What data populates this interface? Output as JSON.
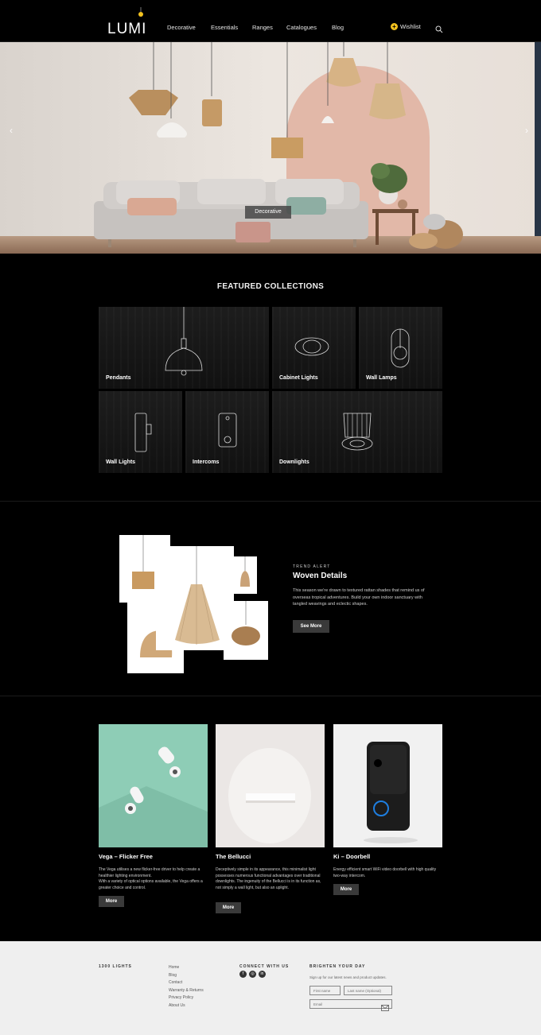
{
  "header": {
    "logo_text": "LUMI",
    "nav": [
      "Decorative",
      "Essentials",
      "Ranges",
      "Catalogues",
      "Blog"
    ],
    "wishlist_label": "Wishlist",
    "wishlist_icon": "plus-circle-icon",
    "search_icon": "search-icon"
  },
  "hero": {
    "label": "Decorative",
    "prev_arrow": "‹",
    "next_arrow": "›"
  },
  "featured": {
    "title": "FEATURED COLLECTIONS",
    "tiles": [
      "Pendants",
      "Cabinet Lights",
      "Wall Lamps",
      "Wall Lights",
      "Intercoms",
      "Downlights"
    ]
  },
  "trend": {
    "kicker": "TREND ALERT",
    "title": "Woven Details",
    "text": "This season we're drawn to textured rattan shades that remind us of overseas tropical adventures. Build your own indoor sanctuary with tangled weavings and eclectic shapes.",
    "button": "See More"
  },
  "products": [
    {
      "title": "Vega – Flicker Free",
      "desc": "The Vega utilises a new flicker-free driver to help create a healthier lighting environment.\nWith a variety of optical options available, the Vega offers a greater choice and control.",
      "button": "More"
    },
    {
      "title": "The Bellucci",
      "desc": "Deceptively simple in its appearance, this minimalist light possesses numerous functional advantages over traditional downlights. The ingenuity of the Bellucci is in its function as, not simply a wall light, but also an uplight.",
      "button": "More"
    },
    {
      "title": "Ki – Doorbell",
      "desc": "Energy efficient smart WiFi video doorbell with high quality two-way intercom.",
      "button": "More"
    }
  ],
  "footer": {
    "brand": "1300 LIGHTS",
    "links": [
      "Home",
      "Blog",
      "Contact",
      "Warranty & Returns",
      "Privacy Policy",
      "About Us"
    ],
    "connect_title": "CONNECT WITH US",
    "social": [
      "f",
      "◎",
      "in"
    ],
    "social_icons": [
      "facebook-icon",
      "instagram-icon",
      "linkedin-icon"
    ],
    "brighten_title": "BRIGHTEN YOUR DAY",
    "signup_text": "Sign up for our latest news and product updates.",
    "first_name_placeholder": "First name",
    "last_name_placeholder": "Last name (Optional)",
    "email_placeholder": "Email"
  }
}
